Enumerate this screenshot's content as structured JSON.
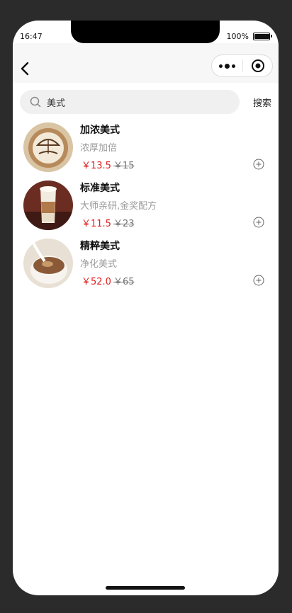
{
  "status": {
    "time": "16:47",
    "battery": "100%",
    "battery_level": 0.95
  },
  "nav": {
    "back_icon": "chevron-left-icon",
    "more_icon": "more-dots-icon",
    "close_icon": "target-circle-icon"
  },
  "search": {
    "value": "美式",
    "placeholder": "",
    "button": "搜索"
  },
  "products": [
    {
      "name": "加浓美式",
      "desc": "浓厚加倍",
      "price": "￥13.5",
      "old_price": "￥15"
    },
    {
      "name": "标准美式",
      "desc": "大师亲研,金奖配方",
      "price": "￥11.5",
      "old_price": "￥23"
    },
    {
      "name": "精粹美式",
      "desc": "净化美式",
      "price": "￥52.0",
      "old_price": "￥65"
    }
  ],
  "colors": {
    "price": "#e02020",
    "muted": "#9a9a9a",
    "page_bg": "#2b2b2b"
  }
}
